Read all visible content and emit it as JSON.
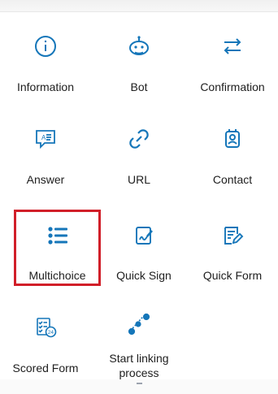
{
  "menu": {
    "items": [
      {
        "label": "Information",
        "icon": "information-icon"
      },
      {
        "label": "Bot",
        "icon": "bot-icon"
      },
      {
        "label": "Confirmation",
        "icon": "confirmation-icon"
      },
      {
        "label": "Answer",
        "icon": "answer-icon"
      },
      {
        "label": "URL",
        "icon": "url-icon"
      },
      {
        "label": "Contact",
        "icon": "contact-icon"
      },
      {
        "label": "Multichoice",
        "icon": "multichoice-icon"
      },
      {
        "label": "Quick Sign",
        "icon": "quick-sign-icon"
      },
      {
        "label": "Quick Form",
        "icon": "quick-form-icon"
      },
      {
        "label": "Scored Form",
        "icon": "scored-form-icon"
      },
      {
        "label": "Start linking process",
        "icon": "linking-process-icon"
      }
    ]
  },
  "colors": {
    "accent": "#1576b9",
    "highlight": "#d11f29",
    "text": "#202020",
    "background": "#ffffff"
  },
  "icon_text": {
    "scored_badge": "24"
  }
}
